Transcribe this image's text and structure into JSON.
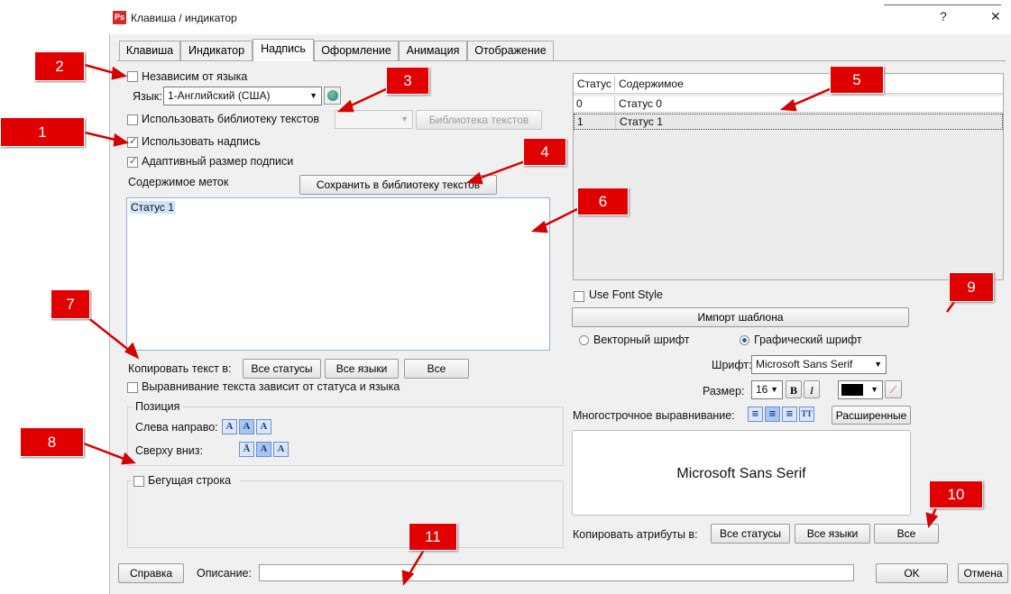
{
  "window": {
    "title": "Клавиша / индикатор",
    "help_glyph": "?",
    "close_glyph": "✕",
    "logo_text": "Ps"
  },
  "tabs": [
    {
      "label": "Клавиша"
    },
    {
      "label": "Индикатор"
    },
    {
      "label": "Надпись",
      "active": true
    },
    {
      "label": "Оформление"
    },
    {
      "label": "Анимация"
    },
    {
      "label": "Отображение"
    }
  ],
  "left": {
    "lang_independent": {
      "label": "Независим от языка",
      "checked": false
    },
    "language": {
      "label": "Язык:",
      "value": "1-Английский (США)"
    },
    "use_text_library": {
      "label": "Использовать библиотеку текстов",
      "checked": false,
      "library_button": "Библиотека текстов"
    },
    "use_label": {
      "label": "Использовать надпись",
      "checked": true
    },
    "adaptive_size": {
      "label": "Адаптивный размер подписи",
      "checked": true
    },
    "content_label": "Содержимое меток",
    "save_to_library": "Сохранить в библиотеку текстов",
    "text_value": "Статус 1",
    "copy_text": {
      "label": "Копировать текст в:",
      "all_statuses": "Все статусы",
      "all_languages": "Все языки",
      "all": "Все"
    },
    "align_depends": {
      "label": "Выравнивание текста зависит от статуса и языка",
      "checked": false
    },
    "position": {
      "title": "Позиция",
      "horizontal": "Слева направо:",
      "vertical": "Сверху вниз:"
    },
    "marquee": {
      "label": "Бегущая строка",
      "checked": false
    }
  },
  "right": {
    "table": {
      "columns": [
        "Статус",
        "Содержимое"
      ],
      "rows": [
        [
          "0",
          "Статус 0"
        ],
        [
          "1",
          "Статус 1"
        ]
      ]
    },
    "use_font_style": {
      "label": "Use Font Style",
      "checked": false
    },
    "import_template": "Импорт шаблона",
    "vector_font": {
      "label": "Векторный шрифт",
      "selected": false
    },
    "bitmap_font": {
      "label": "Графический шрифт",
      "selected": true
    },
    "font": {
      "label": "Шрифт:",
      "value": "Microsoft Sans Serif"
    },
    "size": {
      "label": "Размер:",
      "value": "16"
    },
    "multiline_align": {
      "label": "Многострочное выравнивание:",
      "extended": "Расширенные"
    },
    "preview_text": "Microsoft Sans Serif",
    "copy_attrs": {
      "label": "Копировать атрибуты в:",
      "all_statuses": "Все статусы",
      "all_languages": "Все языки",
      "all": "Все"
    }
  },
  "footer": {
    "help": "Справка",
    "description_label": "Описание:",
    "description_value": "",
    "ok": "OK",
    "cancel": "Отмена"
  },
  "callouts": [
    "1",
    "2",
    "3",
    "4",
    "5",
    "6",
    "7",
    "8",
    "9",
    "10",
    "11"
  ],
  "colors": {
    "callout": "#e00000",
    "selected_text_bg": "#cde3f9",
    "accent": "#2b5fb6"
  }
}
